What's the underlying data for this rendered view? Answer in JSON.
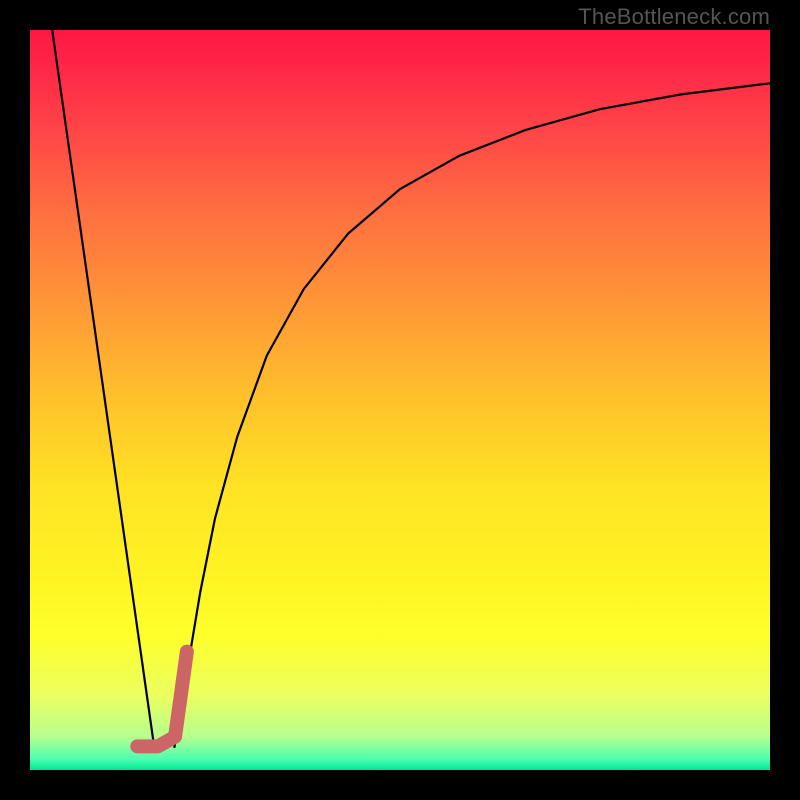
{
  "watermark": "TheBottleneck.com",
  "gradient": {
    "stops": [
      {
        "offset": 0.0,
        "color": "#ff1744"
      },
      {
        "offset": 0.06,
        "color": "#ff2a47"
      },
      {
        "offset": 0.14,
        "color": "#ff4747"
      },
      {
        "offset": 0.25,
        "color": "#ff7040"
      },
      {
        "offset": 0.38,
        "color": "#ff9a36"
      },
      {
        "offset": 0.5,
        "color": "#ffc22b"
      },
      {
        "offset": 0.62,
        "color": "#ffe324"
      },
      {
        "offset": 0.74,
        "color": "#fff423"
      },
      {
        "offset": 0.82,
        "color": "#feff2b"
      },
      {
        "offset": 0.9,
        "color": "#eaff60"
      },
      {
        "offset": 0.955,
        "color": "#b6ff8f"
      },
      {
        "offset": 0.985,
        "color": "#4dffb0"
      },
      {
        "offset": 1.0,
        "color": "#00e596"
      }
    ]
  },
  "chart_data": {
    "type": "line",
    "title": "",
    "xlabel": "",
    "ylabel": "",
    "xlim": [
      0,
      100
    ],
    "ylim": [
      0,
      100
    ],
    "series": [
      {
        "name": "left-line",
        "stroke": "#000000",
        "width": 2.2,
        "x": [
          3,
          16.8
        ],
        "values": [
          100,
          3
        ]
      },
      {
        "name": "right-curve",
        "stroke": "#000000",
        "width": 2.2,
        "x": [
          19.5,
          21,
          23,
          25,
          28,
          32,
          37,
          43,
          50,
          58,
          67,
          77,
          88,
          100
        ],
        "values": [
          3,
          12,
          24,
          34,
          45,
          56,
          65,
          72.5,
          78.5,
          83,
          86.5,
          89.3,
          91.3,
          92.8
        ]
      },
      {
        "name": "j-mark",
        "stroke": "#cc6666",
        "width": 14,
        "linecap": "round",
        "x": [
          14.5,
          17.3,
          19.6,
          21.2
        ],
        "values": [
          3.2,
          3.2,
          4.5,
          16
        ]
      }
    ]
  }
}
